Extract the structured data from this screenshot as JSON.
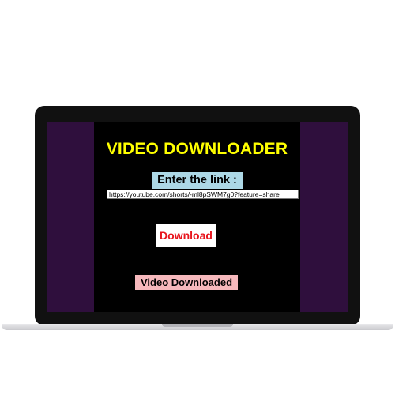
{
  "app": {
    "title": "VIDEO DOWNLOADER"
  },
  "form": {
    "link_label": "Enter the link :",
    "link_value": "https://youtube.com/shorts/-ml8pSWM7g0?feature=share",
    "download_label": "Download"
  },
  "status": {
    "message": "Video Downloaded"
  },
  "colors": {
    "title": "#ffff00",
    "screen_background": "#000000",
    "side_panels": "#2f0f3d",
    "link_label_background": "#add8e6",
    "download_text": "#e8161e",
    "status_background": "#f6b8bc"
  }
}
